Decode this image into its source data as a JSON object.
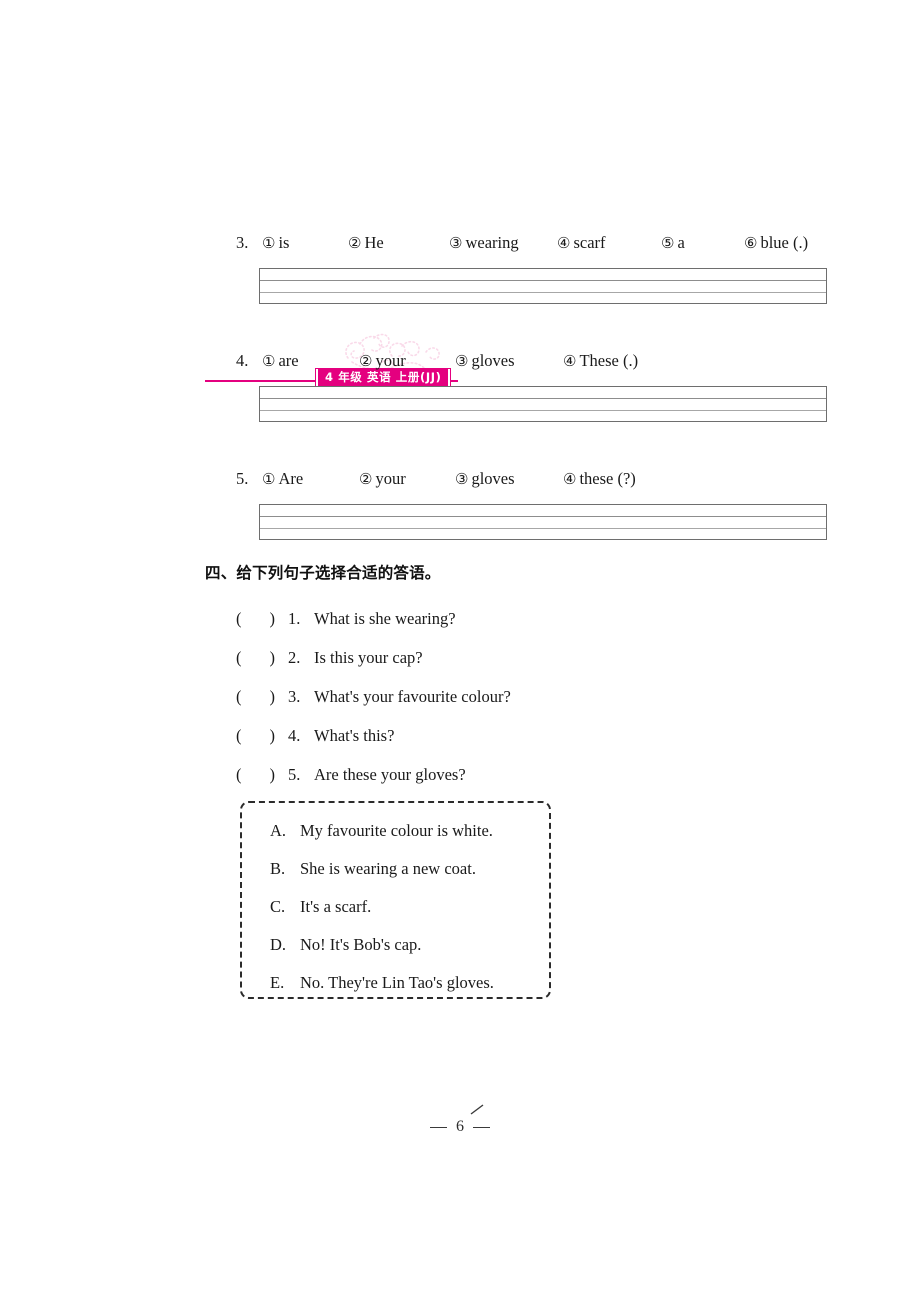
{
  "header": {
    "badge_text": "4 年级 英语 上册(JJ)",
    "accent_color": "#e4007f",
    "floral_icon": "floral-swirl-ornament"
  },
  "reorder_section": {
    "items": [
      {
        "number": "3.",
        "choices": [
          {
            "marker": "①",
            "word": "is"
          },
          {
            "marker": "②",
            "word": "He"
          },
          {
            "marker": "③",
            "word": "wearing"
          },
          {
            "marker": "④",
            "word": "scarf"
          },
          {
            "marker": "⑤",
            "word": "a"
          },
          {
            "marker": "⑥",
            "word": "blue (.)"
          }
        ]
      },
      {
        "number": "4.",
        "choices": [
          {
            "marker": "①",
            "word": "are"
          },
          {
            "marker": "②",
            "word": "your"
          },
          {
            "marker": "③",
            "word": "gloves"
          },
          {
            "marker": "④",
            "word": "These (.)"
          }
        ]
      },
      {
        "number": "5.",
        "choices": [
          {
            "marker": "①",
            "word": "Are"
          },
          {
            "marker": "②",
            "word": "your"
          },
          {
            "marker": "③",
            "word": "gloves"
          },
          {
            "marker": "④",
            "word": "these (?)"
          }
        ]
      }
    ]
  },
  "match_section": {
    "heading": "四、给下列句子选择合适的答语。",
    "questions": [
      {
        "blank_open": "(",
        "blank_close": ")",
        "number": "1.",
        "text": "What is she wearing?"
      },
      {
        "blank_open": "(",
        "blank_close": ")",
        "number": "2.",
        "text": "Is this your cap?"
      },
      {
        "blank_open": "(",
        "blank_close": ")",
        "number": "3.",
        "text": "What's your favourite colour?"
      },
      {
        "blank_open": "(",
        "blank_close": ")",
        "number": "4.",
        "text": "What's this?"
      },
      {
        "blank_open": "(",
        "blank_close": ")",
        "number": "5.",
        "text": "Are these your gloves?"
      }
    ],
    "options": [
      {
        "letter": "A.",
        "text": "My favourite colour is white."
      },
      {
        "letter": "B.",
        "text": "She is wearing a new coat."
      },
      {
        "letter": "C.",
        "text": "It's a scarf."
      },
      {
        "letter": "D.",
        "text": "No! It's Bob's cap."
      },
      {
        "letter": "E.",
        "text": "No. They're Lin Tao's gloves."
      }
    ]
  },
  "footer": {
    "page_number": "6"
  }
}
